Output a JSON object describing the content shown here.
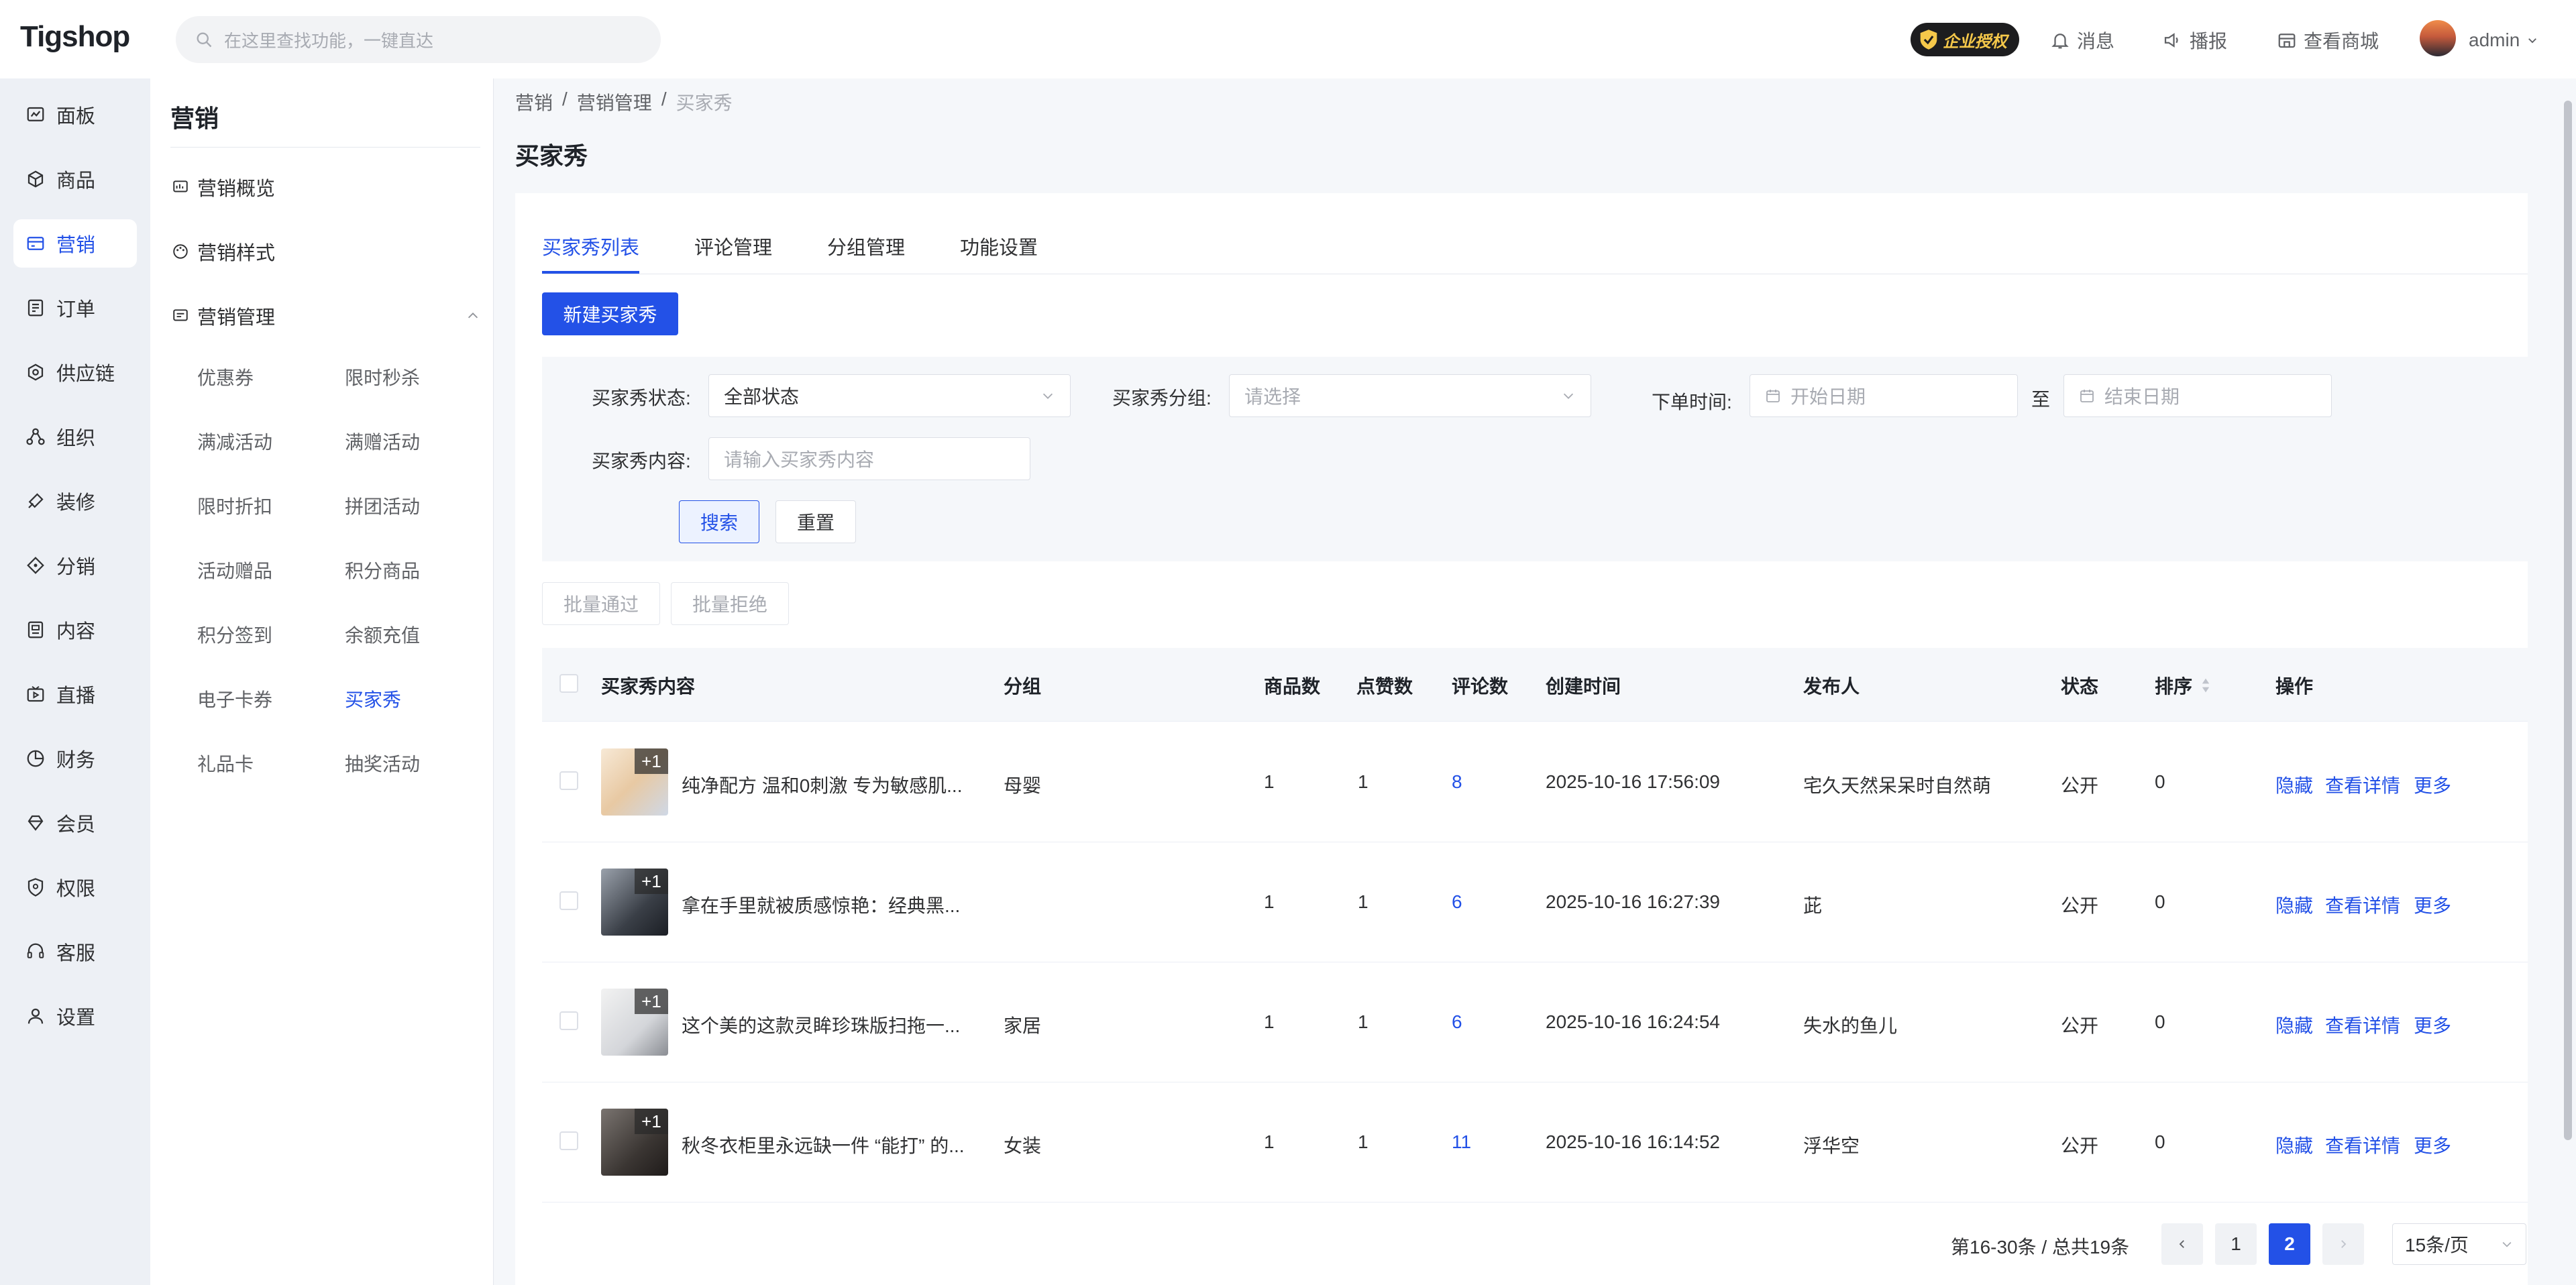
{
  "app": {
    "logo": "Tigshop"
  },
  "header": {
    "search_placeholder": "在这里查找功能，一键直达",
    "license_badge": "企业授权",
    "messages": "消息",
    "broadcast": "播报",
    "view_store": "查看商城",
    "user": "admin"
  },
  "leftnav": {
    "items": [
      {
        "label": "面板",
        "icon": "dashboard-icon"
      },
      {
        "label": "商品",
        "icon": "cube-icon"
      },
      {
        "label": "营销",
        "icon": "marketing-icon"
      },
      {
        "label": "订单",
        "icon": "order-icon"
      },
      {
        "label": "供应链",
        "icon": "supply-icon"
      },
      {
        "label": "组织",
        "icon": "org-icon"
      },
      {
        "label": "装修",
        "icon": "brush-icon"
      },
      {
        "label": "分销",
        "icon": "distribution-icon"
      },
      {
        "label": "内容",
        "icon": "content-icon"
      },
      {
        "label": "直播",
        "icon": "live-icon"
      },
      {
        "label": "财务",
        "icon": "finance-icon"
      },
      {
        "label": "会员",
        "icon": "member-icon"
      },
      {
        "label": "权限",
        "icon": "permission-icon"
      },
      {
        "label": "客服",
        "icon": "service-icon"
      },
      {
        "label": "设置",
        "icon": "settings-icon"
      }
    ],
    "active_index": 2
  },
  "subnav": {
    "title": "营销",
    "groups": [
      {
        "label": "营销概览"
      },
      {
        "label": "营销样式"
      },
      {
        "label": "营销管理"
      }
    ],
    "links": [
      "优惠券",
      "限时秒杀",
      "满减活动",
      "满赠活动",
      "限时折扣",
      "拼团活动",
      "活动赠品",
      "积分商品",
      "积分签到",
      "余额充值",
      "电子卡券",
      "买家秀",
      "礼品卡",
      "抽奖活动"
    ],
    "active_link": "买家秀"
  },
  "breadcrumb": {
    "l1": "营销",
    "l2": "营销管理",
    "l3": "买家秀",
    "sep": "/"
  },
  "page": {
    "title": "买家秀"
  },
  "tabs": [
    "买家秀列表",
    "评论管理",
    "分组管理",
    "功能设置"
  ],
  "new_button": "新建买家秀",
  "filter": {
    "status_label": "买家秀状态:",
    "status_value": "全部状态",
    "group_label": "买家秀分组:",
    "group_placeholder": "请选择",
    "time_label": "下单时间:",
    "start_placeholder": "开始日期",
    "to": "至",
    "end_placeholder": "结束日期",
    "content_label": "买家秀内容:",
    "content_placeholder": "请输入买家秀内容",
    "search": "搜索",
    "reset": "重置"
  },
  "batch": {
    "approve": "批量通过",
    "reject": "批量拒绝"
  },
  "table": {
    "headers": {
      "content": "买家秀内容",
      "group": "分组",
      "goods": "商品数",
      "likes": "点赞数",
      "comments": "评论数",
      "created": "创建时间",
      "author": "发布人",
      "status": "状态",
      "sort": "排序",
      "ops": "操作"
    },
    "rows": [
      {
        "content": "纯净配方 温和0刺激 专为敏感肌...",
        "thumb_extra": "+1",
        "group": "母婴",
        "goods": "1",
        "likes": "1",
        "comments": "8",
        "created": "2025-10-16 17:56:09",
        "author": "宅久天然呆呆时自然萌",
        "status": "公开",
        "sort": "0"
      },
      {
        "content": "拿在手里就被质感惊艳：经典黑...",
        "thumb_extra": "+1",
        "group": "",
        "goods": "1",
        "likes": "1",
        "comments": "6",
        "created": "2025-10-16 16:27:39",
        "author": "茈",
        "status": "公开",
        "sort": "0"
      },
      {
        "content": "这个美的这款灵眸珍珠版扫拖一...",
        "thumb_extra": "+1",
        "group": "家居",
        "goods": "1",
        "likes": "1",
        "comments": "6",
        "created": "2025-10-16 16:24:54",
        "author": "失水的鱼儿",
        "status": "公开",
        "sort": "0"
      },
      {
        "content": "秋冬衣柜里永远缺一件 “能打” 的...",
        "thumb_extra": "+1",
        "group": "女装",
        "goods": "1",
        "likes": "1",
        "comments": "11",
        "created": "2025-10-16 16:14:52",
        "author": "浮华空",
        "status": "公开",
        "sort": "0"
      }
    ],
    "ops": {
      "hide": "隐藏",
      "detail": "查看详情",
      "more": "更多"
    }
  },
  "pagination": {
    "summary": "第16-30条 / 总共19条",
    "pages": [
      "1",
      "2"
    ],
    "current": "2",
    "page_size": "15条/页"
  },
  "colors": {
    "primary": "#2351e7",
    "nav_bg": "#edf0f5"
  }
}
